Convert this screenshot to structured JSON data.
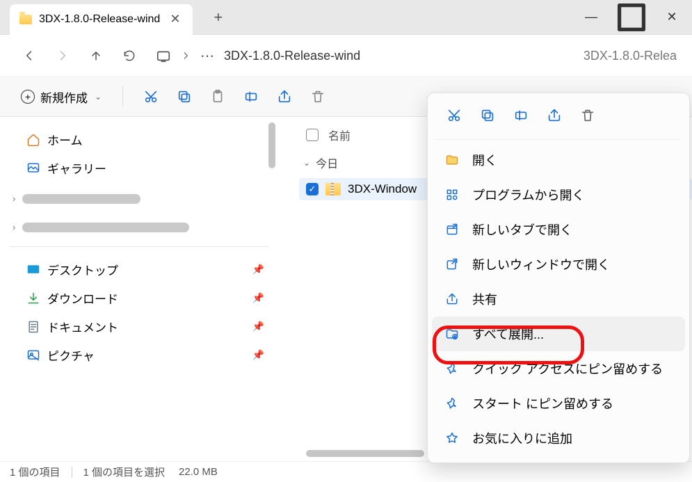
{
  "window": {
    "tab_title": "3DX-1.8.0-Release-wind",
    "minimize": "—",
    "maximize": "▢",
    "close": "✕"
  },
  "nav": {
    "address_text": "3DX-1.8.0-Release-wind",
    "search_placeholder": "3DX-1.8.0-Relea"
  },
  "toolbar": {
    "new_label": "新規作成"
  },
  "sidebar": {
    "home": "ホーム",
    "gallery": "ギャラリー",
    "desktop": "デスクトップ",
    "downloads": "ダウンロード",
    "documents": "ドキュメント",
    "pictures": "ピクチャ"
  },
  "content": {
    "col_name": "名前",
    "group_today": "今日",
    "file1": "3DX-Window"
  },
  "status": {
    "count": "1 個の項目",
    "selection": "1 個の項目を選択",
    "size": "22.0 MB"
  },
  "ctx": {
    "open": "開く",
    "open_with": "プログラムから開く",
    "new_tab": "新しいタブで開く",
    "new_window": "新しいウィンドウで開く",
    "share": "共有",
    "extract_all": "すべて展開...",
    "pin_quick": "クイック アクセスにピン留めする",
    "pin_start": "スタート にピン留めする",
    "add_fav": "お気に入りに追加"
  }
}
